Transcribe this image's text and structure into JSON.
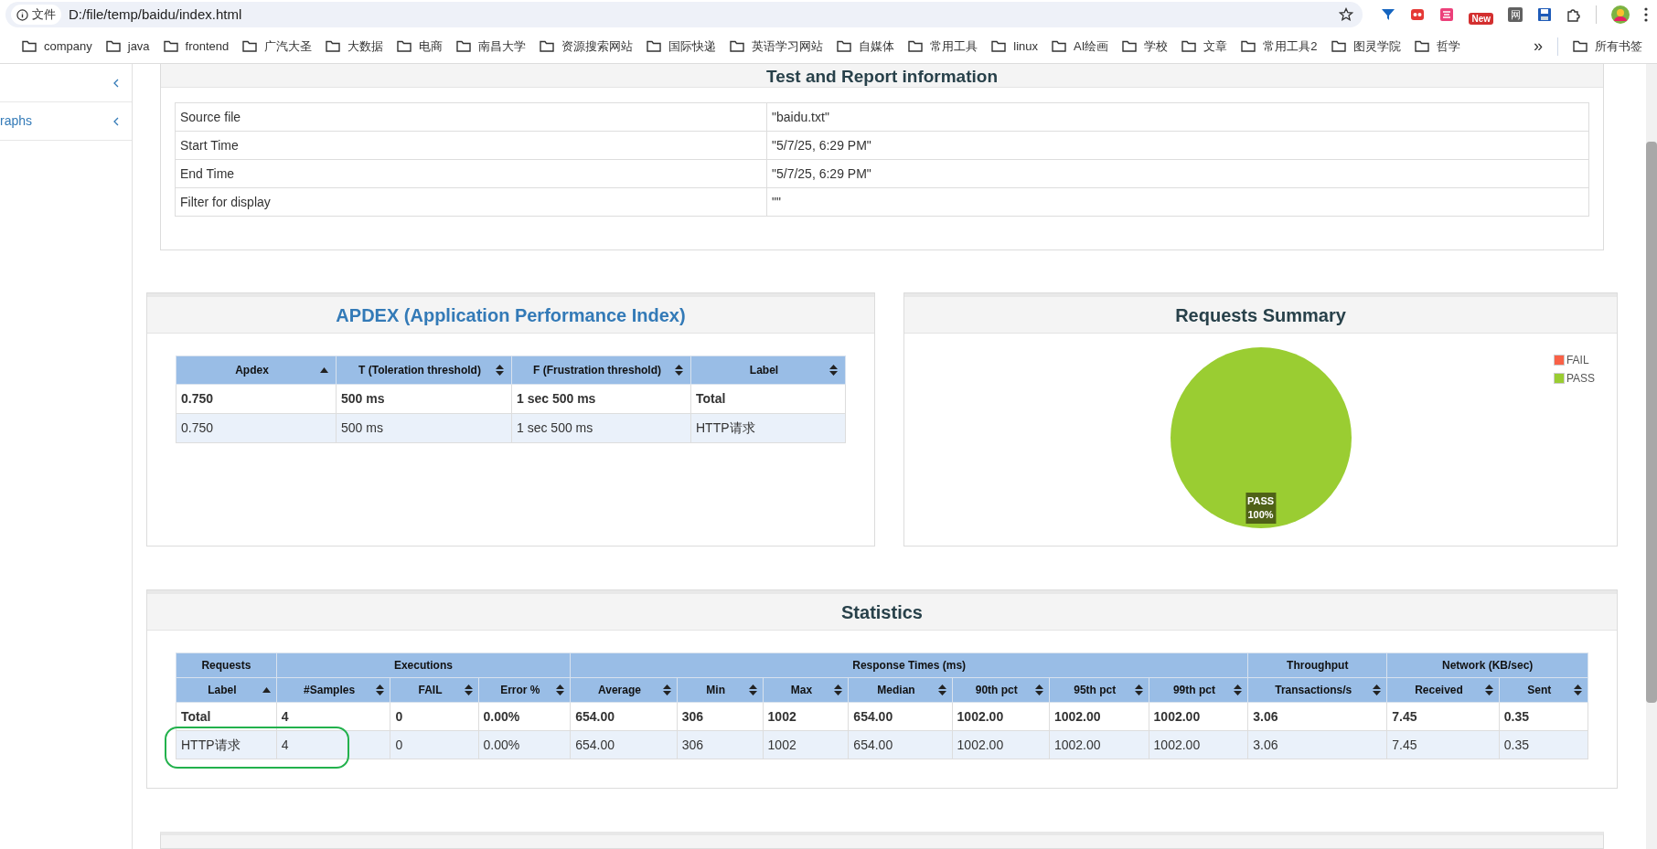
{
  "browser": {
    "address_chip": "文件",
    "url": "D:/file/temp/baidu/index.html",
    "extension_badge": "New",
    "extension_glyph": "网"
  },
  "bookmarks": [
    "company",
    "java",
    "frontend",
    "广汽大圣",
    "大数据",
    "电商",
    "南昌大学",
    "资源搜索网站",
    "国际快递",
    "英语学习网站",
    "自媒体",
    "常用工具",
    "linux",
    "AI绘画",
    "学校",
    "文章",
    "常用工具2",
    "图灵学院",
    "哲学"
  ],
  "bookmarks_more": "»",
  "all_bookmarks": "所有书签",
  "sidebar": {
    "items": [
      {
        "expanded": false
      },
      {
        "label": "raphs",
        "expanded": false
      }
    ]
  },
  "report_info": {
    "title": "Test and Report information",
    "rows": [
      {
        "name": "Source file",
        "value": "\"baidu.txt\""
      },
      {
        "name": "Start Time",
        "value": "\"5/7/25, 6:29 PM\""
      },
      {
        "name": "End Time",
        "value": "\"5/7/25, 6:29 PM\""
      },
      {
        "name": "Filter for display",
        "value": "\"\""
      }
    ]
  },
  "apdex": {
    "title": "APDEX (Application Performance Index)",
    "columns": [
      {
        "label": "Apdex",
        "sorted_ascending": true
      },
      {
        "label": "T (Toleration threshold)",
        "sorted_ascending": false
      },
      {
        "label": "F (Frustration threshold)",
        "sorted_ascending": false
      },
      {
        "label": "Label",
        "sorted_ascending": false
      }
    ],
    "rows": [
      {
        "total": true,
        "cells": [
          "0.750",
          "500 ms",
          "1 sec 500 ms",
          "Total"
        ]
      },
      {
        "total": false,
        "cells": [
          "0.750",
          "500 ms",
          "1 sec 500 ms",
          "HTTP请求"
        ]
      }
    ]
  },
  "requests_summary": {
    "title": "Requests Summary",
    "chart_data": {
      "type": "pie",
      "categories": [
        "FAIL",
        "PASS"
      ],
      "values": [
        0,
        100
      ],
      "colors": [
        "#f96147",
        "#9acd32"
      ],
      "value_labels": [
        null,
        "100%"
      ]
    }
  },
  "statistics": {
    "title": "Statistics",
    "groups": [
      "Requests",
      "Executions",
      "Response Times (ms)",
      "Throughput",
      "Network (KB/sec)"
    ],
    "columns": [
      {
        "label": "Label",
        "sorted_ascending": true
      },
      {
        "label": "#Samples",
        "sorted_ascending": false
      },
      {
        "label": "FAIL",
        "sorted_ascending": false
      },
      {
        "label": "Error %",
        "sorted_ascending": false
      },
      {
        "label": "Average",
        "sorted_ascending": false
      },
      {
        "label": "Min",
        "sorted_ascending": false
      },
      {
        "label": "Max",
        "sorted_ascending": false
      },
      {
        "label": "Median",
        "sorted_ascending": false
      },
      {
        "label": "90th pct",
        "sorted_ascending": false
      },
      {
        "label": "95th pct",
        "sorted_ascending": false
      },
      {
        "label": "99th pct",
        "sorted_ascending": false
      },
      {
        "label": "Transactions/s",
        "sorted_ascending": false
      },
      {
        "label": "Received",
        "sorted_ascending": false
      },
      {
        "label": "Sent",
        "sorted_ascending": false
      }
    ],
    "rows": [
      {
        "total": true,
        "highlighted": false,
        "cells": [
          "Total",
          "4",
          "0",
          "0.00%",
          "654.00",
          "306",
          "1002",
          "654.00",
          "1002.00",
          "1002.00",
          "1002.00",
          "3.06",
          "7.45",
          "0.35"
        ]
      },
      {
        "total": false,
        "highlighted": true,
        "cells": [
          "HTTP请求",
          "4",
          "0",
          "0.00%",
          "654.00",
          "306",
          "1002",
          "654.00",
          "1002.00",
          "1002.00",
          "1002.00",
          "3.06",
          "7.45",
          "0.35"
        ]
      }
    ]
  }
}
